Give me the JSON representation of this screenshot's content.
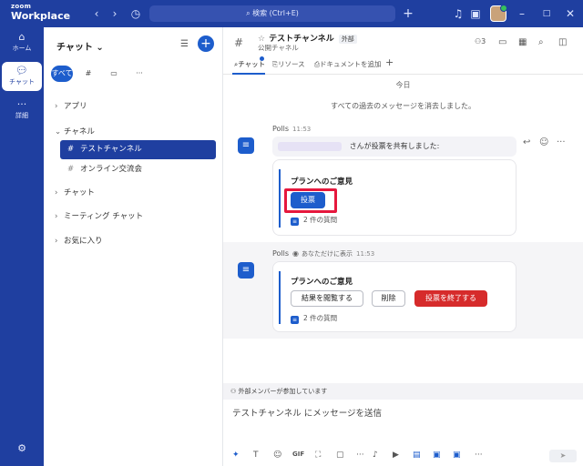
{
  "app": {
    "brand_top": "zoom",
    "brand_bottom": "Workplace",
    "search_placeholder": "検索 (Ctrl+E)",
    "accent": "#1f3fa0",
    "primary": "#1d5dcc",
    "danger": "#d62b2b"
  },
  "titlebar_icons": [
    "back-icon",
    "forward-icon",
    "history-icon",
    "add-icon",
    "notification-icon",
    "window-icon",
    "minimize-icon",
    "maximize-icon",
    "close-icon"
  ],
  "rail": {
    "home": "ホーム",
    "chat": "チャット",
    "more": "詳細"
  },
  "sidebar": {
    "title": "チャット",
    "tab_all": "すべて",
    "sections": {
      "apps": "アプリ",
      "channels": "チャネル",
      "chats": "チャット",
      "meeting_chats": "ミーティング チャット",
      "favorites": "お気に入り"
    },
    "channels": [
      {
        "name": "テストチャンネル"
      },
      {
        "name": "オンライン交流会"
      }
    ]
  },
  "channel": {
    "name": "テストチャンネル",
    "badge": "外部",
    "subtitle": "公開チャネル",
    "member_count": "3",
    "tabs": {
      "chat": "チャット",
      "resources": "リソース",
      "add_doc": "ドキュメントを追加"
    }
  },
  "feed": {
    "date": "今日",
    "cleared": "すべての過去のメッセージを消去しました。",
    "msg1": {
      "sender": "Polls",
      "time": "11:53",
      "share_text": "さんが投票を共有しました:",
      "poll_title": "プランへのご意見",
      "vote_button": "投票",
      "questions": "2 件の質問"
    },
    "msg2": {
      "sender": "Polls",
      "visibility": "あなただけに表示",
      "time": "11:53",
      "poll_title": "プランへのご意見",
      "view_results": "結果を閲覧する",
      "delete": "削除",
      "end_poll": "投票を終了する",
      "questions": "2 件の質問"
    }
  },
  "composer": {
    "external_note": "外部メンバーが参加しています",
    "placeholder": "テストチャンネル にメッセージを送信",
    "gif": "GIF"
  }
}
